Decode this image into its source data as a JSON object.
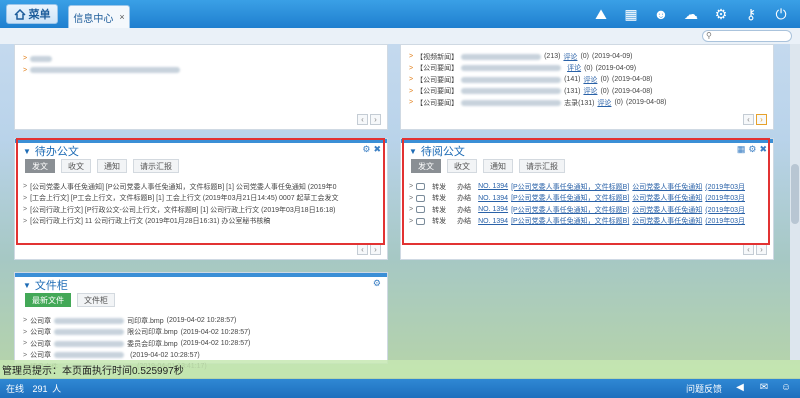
{
  "topbar": {
    "menu_label": "菜单",
    "tab_label": "信息中心",
    "tab_close": "×",
    "icons": [
      "cloud-upload-icon",
      "grid-add-icon",
      "user-icon",
      "cloud-question-icon",
      "gear-icon",
      "key-icon",
      "power-icon"
    ]
  },
  "search": {
    "placeholder": ""
  },
  "news_panel": {
    "rows": [
      {
        "prefix": "【视频新闻】",
        "tail": "(213)",
        "comment": "评论",
        "count": "(0)",
        "date": "(2019-04-09)"
      },
      {
        "prefix": "【公司要闻】",
        "tail": "",
        "comment": "评论",
        "count": "(0)",
        "date": "(2019-04-09)"
      },
      {
        "prefix": "【公司要闻】",
        "tail": "(141)",
        "comment": "评论",
        "count": "(0)",
        "date": "(2019-04-08)"
      },
      {
        "prefix": "【公司要闻】",
        "tail": "(131)",
        "comment": "评论",
        "count": "(0)",
        "date": "(2019-04-08)"
      },
      {
        "prefix": "【公司要闻】",
        "tail": "志录(131)",
        "comment": "评论",
        "count": "(0)",
        "date": "(2019-04-08)"
      }
    ]
  },
  "todo_panel": {
    "title": "待办公文",
    "tabs": [
      "发文",
      "收文",
      "通知",
      "请示汇报"
    ],
    "rows": [
      "[公司党委人事任免通知] [P公司党委人事任免通知，文件标题B]  [1]  公司党委人事任免通知  (2019年0",
      "[工会上行文] [P工会上行文，文件标题B]  [1]  工会上行文 (2019年03月21日14:45) 0007 起草工会发文",
      "[公司行政上行文] [P行政公文-公司上行文，文件标题B]  [1]  公司行政上行文 (2019年03月18日16:18)",
      "[公司行政上行文]  11  公司行政上行文 (2019年01月28日16:31)  办公室秘书核稿"
    ]
  },
  "read_panel": {
    "title": "待阅公文",
    "tabs": [
      "发文",
      "收文",
      "通知",
      "请示汇报"
    ],
    "rows": [
      {
        "op": "转发",
        "act": "办结",
        "num": "NO. 1394",
        "doc": "[P公司党委人事任免通知，文件标题B]",
        "title": "公司党委人事任免通知",
        "date": "(2019年03月"
      },
      {
        "op": "转发",
        "act": "办结",
        "num": "NO. 1394",
        "doc": "[P公司党委人事任免通知，文件标题B]",
        "title": "公司党委人事任免通知",
        "date": "(2019年03月"
      },
      {
        "op": "转发",
        "act": "办结",
        "num": "NO. 1394",
        "doc": "[P公司党委人事任免通知，文件标题B]",
        "title": "公司党委人事任免通知",
        "date": "(2019年03月"
      },
      {
        "op": "转发",
        "act": "办结",
        "num": "NO. 1394",
        "doc": "[P公司党委人事任免通知，文件标题B]",
        "title": "公司党委人事任免通知",
        "date": "(2019年03月"
      }
    ]
  },
  "file_panel": {
    "title": "文件柜",
    "tabs": [
      "最新文件",
      "文件柜"
    ],
    "rows": [
      {
        "prefix": "公司章",
        "tail": "司印章.bmp",
        "date": "(2019-04-02 10:28:57)"
      },
      {
        "prefix": "公司章",
        "tail": "限公司印章.bmp",
        "date": "(2019-04-02 10:28:57)"
      },
      {
        "prefix": "公司章",
        "tail": "委员会印章.bmp",
        "date": "(2019-04-02 10:28:57)"
      },
      {
        "prefix": "公司章",
        "tail": "",
        "date": "(2019-04-02 10:28:57)"
      },
      {
        "prefix": "精品文件",
        "tail": "",
        "date": "(2019-04-01 13:41:17)"
      }
    ]
  },
  "tip": {
    "text": "管理员提示：本页面执行时间0.525997秒"
  },
  "status": {
    "online_label": "在线",
    "online_count": "291",
    "online_unit": "人",
    "feedback": "问题反馈"
  }
}
